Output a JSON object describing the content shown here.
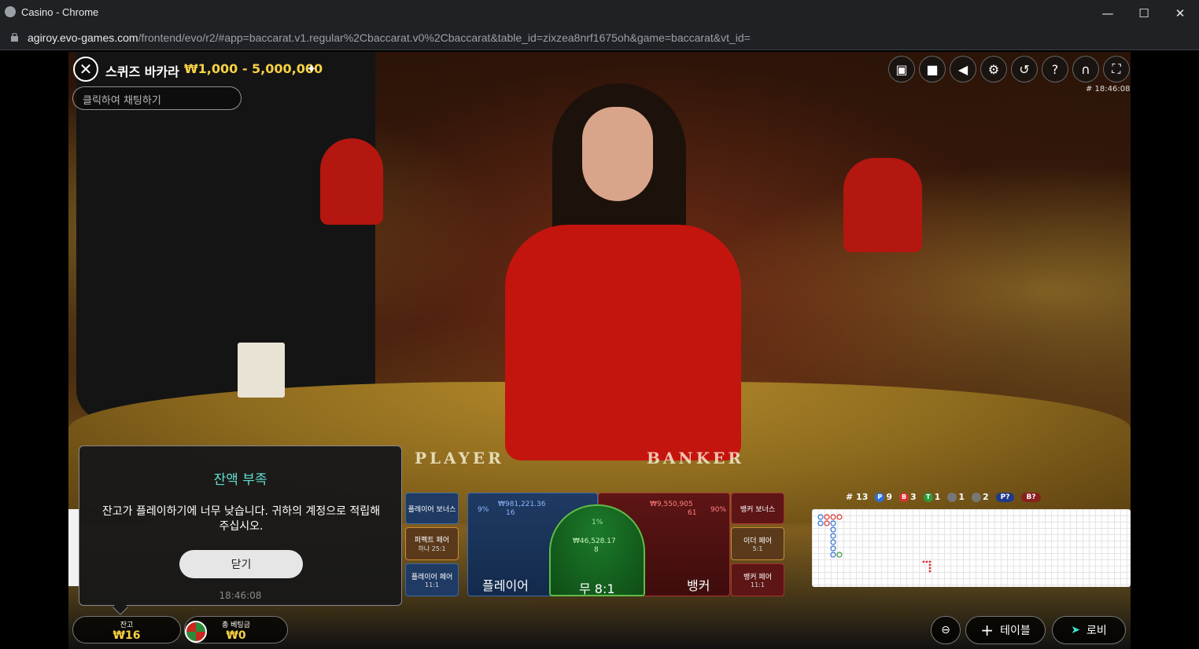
{
  "window": {
    "title": "Casino - Chrome",
    "minimize": "—",
    "maximize": "☐",
    "close": "✕"
  },
  "address": {
    "host": "agiroy.evo-games.com",
    "path": "/frontend/evo/r2/#app=baccarat.v1.regular%2Cbaccarat.v0%2Cbaccarat&table_id=zixzea8nrf1675oh&game=baccarat&vt_id="
  },
  "game": {
    "title": "스퀴즈 바카라",
    "limits": "₩1,000 - 5,000,000",
    "chat_placeholder": "클릭하여 채팅하기",
    "game_id": "# 18:46:08",
    "felt_player": "PLAYER",
    "felt_banker": "BANKER"
  },
  "toolbar": [
    "chat-icon",
    "video-icon",
    "volume-icon",
    "settings-icon",
    "history-icon",
    "help-icon",
    "headset-icon",
    "fullscreen-icon"
  ],
  "bets": {
    "player_bonus": "플레이어 보너스",
    "perfect_pair": "퍼펙트 페어",
    "perfect_pair_odds": "하나 25:1",
    "player_pair": "플레이어 페어",
    "player_pair_odds": "11:1",
    "player": "플레이어",
    "player_pct": "9%",
    "player_amount": "₩981,221.36",
    "player_count": "16",
    "tie": "무 8:1",
    "tie_pct": "1%",
    "tie_amount": "₩46,528.17",
    "tie_count": "8",
    "banker": "뱅커",
    "banker_pct": "90%",
    "banker_amount": "₩9,550,905",
    "banker_count": "61",
    "banker_bonus": "뱅커 보너스",
    "either_pair": "이더 페어",
    "either_pair_odds": "5:1",
    "banker_pair": "뱅커 페어",
    "banker_pair_odds": "11:1"
  },
  "stats": {
    "round": "# 13",
    "player": "9",
    "banker": "3",
    "tie": "1",
    "player_pair": "1",
    "banker_pair": "2",
    "player_predict": "P?",
    "banker_predict": "B?"
  },
  "dialog": {
    "title": "잔액 부족",
    "message": "잔고가 플레이하기에 너무 낮습니다. 귀하의 계정으로 적립해 주십시오.",
    "button": "닫기",
    "time": "18:46:08"
  },
  "footer": {
    "balance_label": "잔고",
    "balance_value": "₩16",
    "bet_label": "총 베팅금",
    "bet_value": "₩0",
    "table_button": "테이블",
    "lobby_button": "로비"
  }
}
